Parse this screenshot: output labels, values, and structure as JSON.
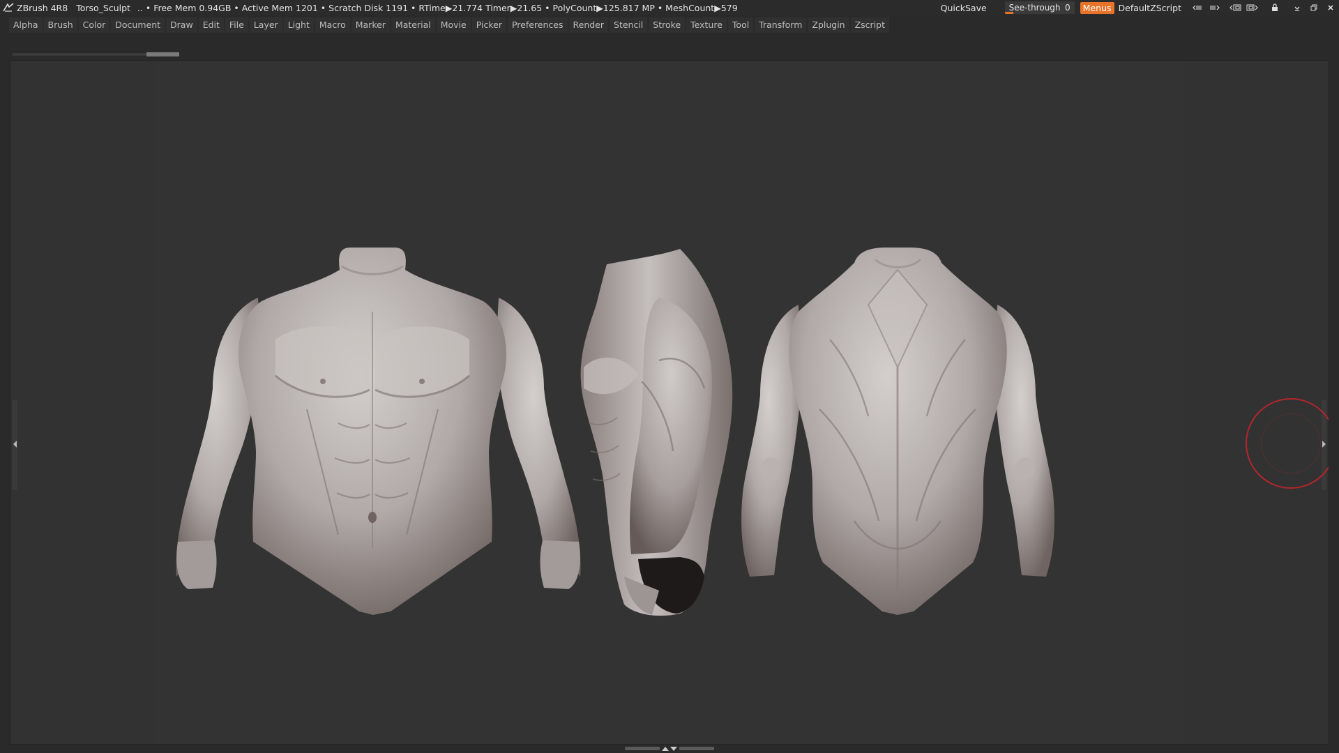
{
  "titlebar": {
    "app_name": "ZBrush 4R8",
    "document_name": "Torso_Sculpt",
    "stats": "..  • Free Mem 0.94GB • Active Mem 1201 • Scratch Disk 1191 •  RTime▶21.774 Timer▶21.65 • PolyCount▶125.817 MP  • MeshCount▶579",
    "quicksave_label": "QuickSave",
    "seethrough_label": "See-through",
    "seethrough_value": "0",
    "seethrough_fraction": 0.12,
    "menus_label": "Menus",
    "script_label": "DefaultZScript",
    "icons": [
      "layout-prev-icon",
      "layout-next-icon",
      "window-shrink-icon",
      "window-expand-icon",
      "lock-icon",
      "minimize-icon",
      "maximize-icon",
      "close-icon"
    ]
  },
  "menubar": {
    "items": [
      "Alpha",
      "Brush",
      "Color",
      "Document",
      "Draw",
      "Edit",
      "File",
      "Layer",
      "Light",
      "Macro",
      "Marker",
      "Material",
      "Movie",
      "Picker",
      "Preferences",
      "Render",
      "Stencil",
      "Stroke",
      "Texture",
      "Tool",
      "Transform",
      "Zplugin",
      "Zscript"
    ]
  },
  "colors": {
    "accent": "#e8742a",
    "background": "#2a2a2a",
    "canvas": "#323232",
    "brush_cursor": "#b3262a",
    "clay": "#b8b2b0"
  }
}
